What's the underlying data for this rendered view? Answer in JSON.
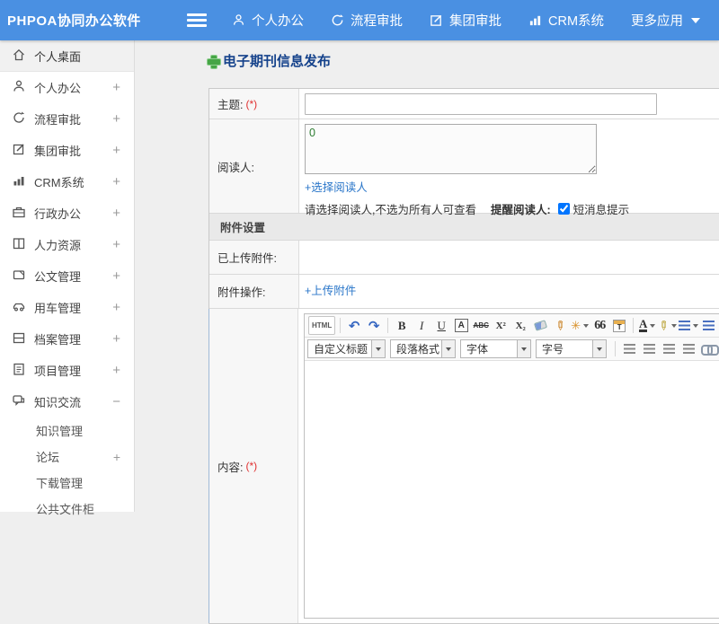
{
  "app": {
    "title": "PHPOA协同办公软件"
  },
  "header": {
    "nav": [
      {
        "label": "个人办公"
      },
      {
        "label": "流程审批"
      },
      {
        "label": "集团审批"
      },
      {
        "label": "CRM系统"
      },
      {
        "label": "更多应用"
      }
    ]
  },
  "sidebar": {
    "items": [
      {
        "label": "个人桌面",
        "expand": ""
      },
      {
        "label": "个人办公",
        "expand": "+"
      },
      {
        "label": "流程审批",
        "expand": "+"
      },
      {
        "label": "集团审批",
        "expand": "+"
      },
      {
        "label": "CRM系统",
        "expand": "+"
      },
      {
        "label": "行政办公",
        "expand": "+"
      },
      {
        "label": "人力资源",
        "expand": "+"
      },
      {
        "label": "公文管理",
        "expand": "+"
      },
      {
        "label": "用车管理",
        "expand": "+"
      },
      {
        "label": "档案管理",
        "expand": "+"
      },
      {
        "label": "项目管理",
        "expand": "+"
      },
      {
        "label": "知识交流",
        "expand": "−"
      }
    ],
    "subitems": [
      {
        "label": "知识管理",
        "expand": ""
      },
      {
        "label": "论坛",
        "expand": "+"
      },
      {
        "label": "下载管理",
        "expand": ""
      },
      {
        "label": "公共文件柜",
        "expand": ""
      }
    ]
  },
  "main": {
    "page_title": "电子期刊信息发布",
    "form": {
      "subject_label": "主题:",
      "required_mark": "(*)",
      "readers_label": "阅读人:",
      "readers_value": "0",
      "select_readers_link": "+选择阅读人",
      "readers_hint": "请选择阅读人,不选为所有人可查看",
      "remind_label": "提醒阅读人:",
      "sms_hint": "短消息提示",
      "attachment_section_title": "附件设置",
      "uploaded_label": "已上传附件:",
      "action_label": "附件操作:",
      "upload_link": "+上传附件",
      "content_label": "内容:"
    },
    "editor": {
      "buttons": {
        "html": "HTML",
        "bold": "B",
        "italic": "I",
        "underline": "U",
        "fontbox": "A",
        "strike": "ABC",
        "sup": "X²",
        "sub": "X₂",
        "undo": "↶",
        "redo": "↷",
        "brush": "✏",
        "wand": "✳",
        "quote": "66",
        "paste": "T",
        "fontcolor": "A",
        "highlight": "✏"
      },
      "dropdowns": [
        {
          "label": "自定义标题"
        },
        {
          "label": "段落格式"
        },
        {
          "label": "字体"
        },
        {
          "label": "字号"
        }
      ]
    }
  },
  "colors": {
    "header_bg": "#4a90e2",
    "page_title": "#15428b",
    "link": "#2a76c9",
    "required": "#e03030",
    "readers_value": "#2e7d32",
    "section_bar_bg": "#e9e9e9"
  }
}
